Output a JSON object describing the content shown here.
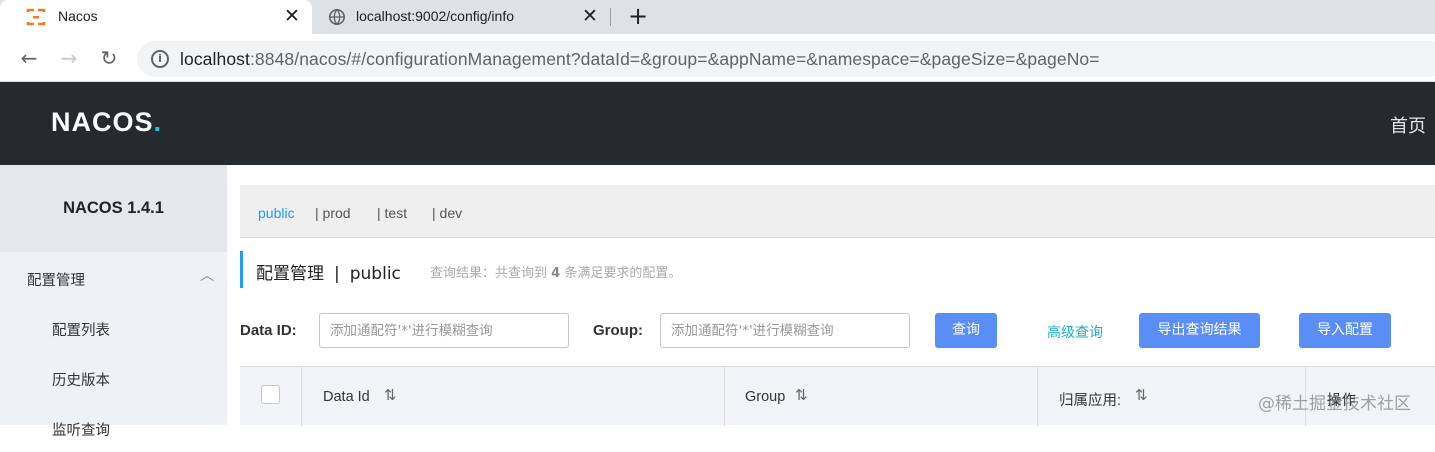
{
  "browser": {
    "tabs": [
      {
        "title": "Nacos",
        "active": true
      },
      {
        "title": "localhost:9002/config/info",
        "active": false
      }
    ],
    "url_host": "localhost",
    "url_rest": ":8848/nacos/#/configurationManagement?dataId=&group=&appName=&namespace=&pageSize=&pageNo="
  },
  "header": {
    "logo_main": "NACOS",
    "logo_dot": ".",
    "nav_home": "首页"
  },
  "sidebar": {
    "version": "NACOS 1.4.1",
    "group_label": "配置管理",
    "items": [
      {
        "label": "配置列表"
      },
      {
        "label": "历史版本"
      },
      {
        "label": "监听查询"
      }
    ]
  },
  "namespaces": [
    {
      "label": "public",
      "active": true
    },
    {
      "label": "| prod",
      "active": false
    },
    {
      "label": "| test",
      "active": false
    },
    {
      "label": "| dev",
      "active": false
    }
  ],
  "page": {
    "title": "配置管理",
    "separator": "|",
    "namespace": "public",
    "result_prefix": "查询结果：共查询到",
    "result_count": "4",
    "result_suffix": "条满足要求的配置。"
  },
  "search": {
    "dataid_label": "Data ID:",
    "dataid_placeholder": "添加通配符'*'进行模糊查询",
    "group_label": "Group:",
    "group_placeholder": "添加通配符'*'进行模糊查询",
    "query_button": "查询",
    "advanced_link": "高级查询",
    "export_button": "导出查询结果",
    "import_button": "导入配置"
  },
  "table": {
    "columns": [
      "Data Id",
      "Group",
      "归属应用:",
      "操作"
    ]
  },
  "watermark": "@稀土掘金技术社区",
  "colors": {
    "accent": "#209bfa",
    "header_bg": "#252a2f",
    "button_blue": "#5a8ef7",
    "link": "#1ab1cf"
  }
}
